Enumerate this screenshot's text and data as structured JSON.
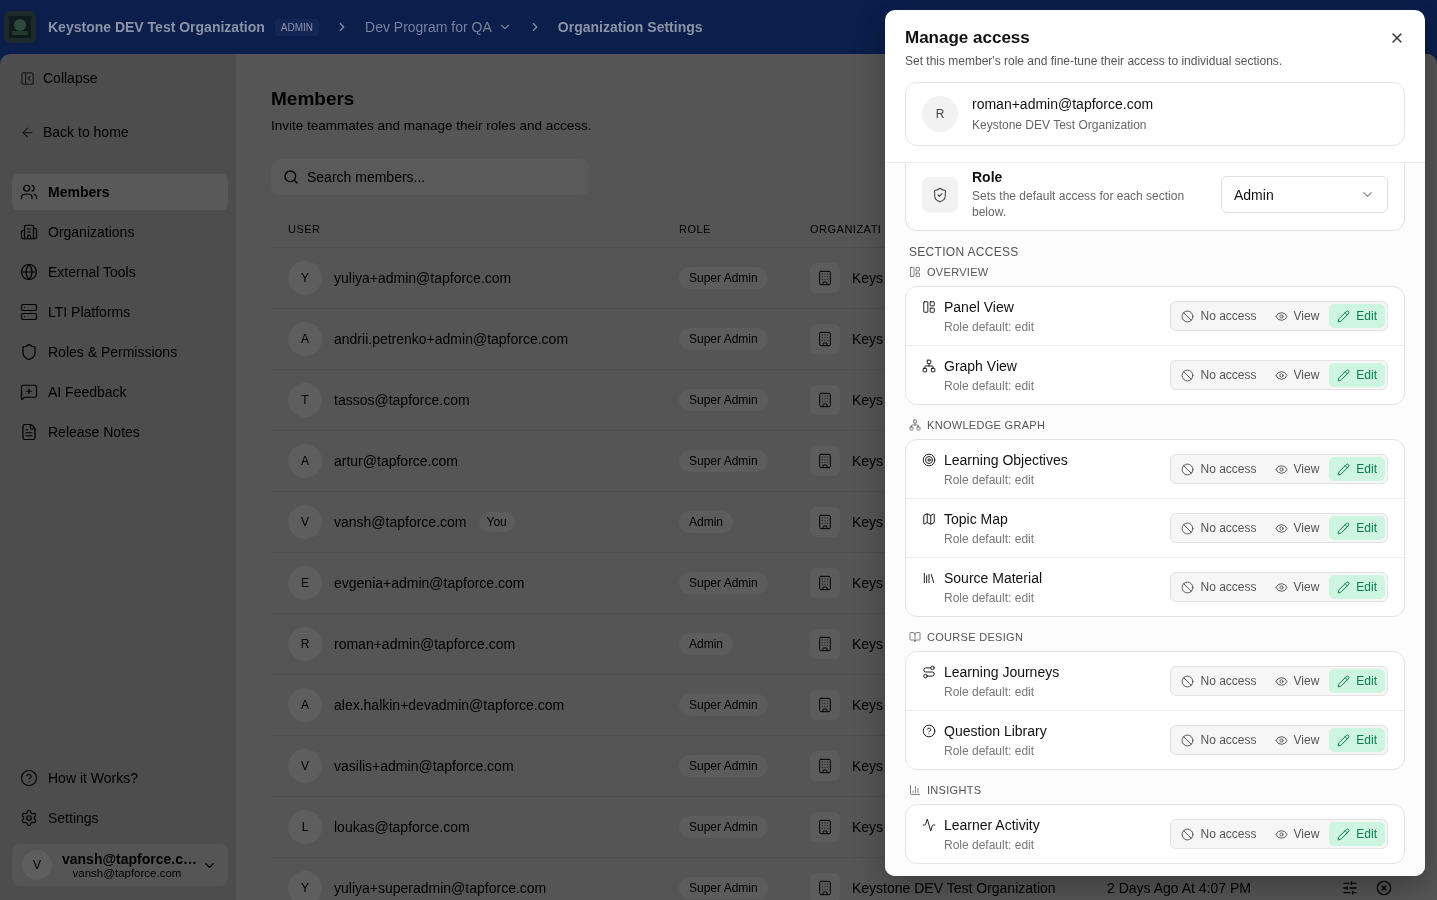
{
  "top_bar": {
    "org_name": "Keystone DEV Test Organization",
    "org_badge": "ADMIN",
    "program": "Dev Program for QA",
    "page": "Organization Settings"
  },
  "sidebar": {
    "collapse": "Collapse",
    "back": "Back to home",
    "items": [
      {
        "kind": "members",
        "label": "Members",
        "selected": true
      },
      {
        "kind": "organizations",
        "label": "Organizations",
        "selected": false
      },
      {
        "kind": "tools",
        "label": "External Tools",
        "selected": false
      },
      {
        "kind": "platforms",
        "label": "LTI Platforms",
        "selected": false
      },
      {
        "kind": "roles",
        "label": "Roles & Permissions",
        "selected": false
      },
      {
        "kind": "feedback",
        "label": "AI Feedback",
        "selected": false
      },
      {
        "kind": "notes",
        "label": "Release Notes",
        "selected": false
      }
    ],
    "footer_items": [
      {
        "kind": "help",
        "label": "How it Works?"
      },
      {
        "kind": "settings",
        "label": "Settings"
      }
    ],
    "user": {
      "initial": "V",
      "name": "vansh@tapforce.c…",
      "email": "vansh@tapforce.com"
    }
  },
  "members": {
    "title": "Members",
    "subtitle": "Invite teammates and manage their roles and access.",
    "search": {
      "placeholder": "Search members..."
    },
    "columns": [
      "USER",
      "ROLE",
      "ORGANIZATI"
    ],
    "rows": [
      {
        "initial": "Y",
        "email": "yuliya+admin@tapforce.com",
        "role": "Super Admin",
        "organization": "Keys"
      },
      {
        "initial": "A",
        "email": "andrii.petrenko+admin@tapforce.com",
        "role": "Super Admin",
        "organization": "Keys"
      },
      {
        "initial": "T",
        "email": "tassos@tapforce.com",
        "role": "Super Admin",
        "organization": "Keys"
      },
      {
        "initial": "A",
        "email": "artur@tapforce.com",
        "role": "Super Admin",
        "organization": "Keys"
      },
      {
        "initial": "V",
        "email": "vansh@tapforce.com",
        "badge": "You",
        "role": "Admin",
        "organization": "Keys"
      },
      {
        "initial": "E",
        "email": "evgenia+admin@tapforce.com",
        "role": "Super Admin",
        "organization": "Keys"
      },
      {
        "initial": "R",
        "email": "roman+admin@tapforce.com",
        "role": "Admin",
        "organization": "Keys"
      },
      {
        "initial": "A",
        "email": "alex.halkin+devadmin@tapforce.com",
        "role": "Super Admin",
        "organization": "Keys"
      },
      {
        "initial": "V",
        "email": "vasilis+admin@tapforce.com",
        "role": "Super Admin",
        "organization": "Keys"
      },
      {
        "initial": "L",
        "email": "loukas@tapforce.com",
        "role": "Super Admin",
        "organization": "Keys"
      },
      {
        "initial": "Y",
        "email": "yuliya+superadmin@tapforce.com",
        "role": "Super Admin",
        "organization": "Keystone DEV Test Organization",
        "last_active": "2 Days Ago At 4:07 PM"
      }
    ]
  },
  "modal": {
    "title": "Manage access",
    "subtitle": "Set this member's role and fine-tune their access to individual sections.",
    "member": {
      "initial": "R",
      "email": "roman+admin@tapforce.com",
      "organization": "Keystone DEV Test Organization"
    },
    "role": {
      "label": "Role",
      "description": "Sets the default access for each section below.",
      "value": "Admin"
    },
    "section_access_label": "SECTION ACCESS",
    "groups": [
      {
        "kind": "overview",
        "title": "OVERVIEW",
        "items": [
          {
            "kind": "panel",
            "name": "Panel View",
            "default": "Role default: edit",
            "options": [
              {
                "kind": "none",
                "label": "No access",
                "selected": false
              },
              {
                "kind": "view",
                "label": "View",
                "selected": false
              },
              {
                "kind": "edit",
                "label": "Edit",
                "selected": true
              }
            ]
          },
          {
            "kind": "graph",
            "name": "Graph View",
            "default": "Role default: edit",
            "options": [
              {
                "kind": "none",
                "label": "No access",
                "selected": false
              },
              {
                "kind": "view",
                "label": "View",
                "selected": false
              },
              {
                "kind": "edit",
                "label": "Edit",
                "selected": true
              }
            ]
          }
        ]
      },
      {
        "kind": "graph",
        "title": "KNOWLEDGE GRAPH",
        "items": [
          {
            "kind": "target",
            "name": "Learning Objectives",
            "default": "Role default: edit",
            "options": [
              {
                "kind": "none",
                "label": "No access",
                "selected": false
              },
              {
                "kind": "view",
                "label": "View",
                "selected": false
              },
              {
                "kind": "edit",
                "label": "Edit",
                "selected": true
              }
            ]
          },
          {
            "kind": "map",
            "name": "Topic Map",
            "default": "Role default: edit",
            "options": [
              {
                "kind": "none",
                "label": "No access",
                "selected": false
              },
              {
                "kind": "view",
                "label": "View",
                "selected": false
              },
              {
                "kind": "edit",
                "label": "Edit",
                "selected": true
              }
            ]
          },
          {
            "kind": "library",
            "name": "Source Material",
            "default": "Role default: edit",
            "options": [
              {
                "kind": "none",
                "label": "No access",
                "selected": false
              },
              {
                "kind": "view",
                "label": "View",
                "selected": false
              },
              {
                "kind": "edit",
                "label": "Edit",
                "selected": true
              }
            ]
          }
        ]
      },
      {
        "kind": "book",
        "title": "COURSE DESIGN",
        "items": [
          {
            "kind": "route",
            "name": "Learning Journeys",
            "default": "Role default: edit",
            "options": [
              {
                "kind": "none",
                "label": "No access",
                "selected": false
              },
              {
                "kind": "view",
                "label": "View",
                "selected": false
              },
              {
                "kind": "edit",
                "label": "Edit",
                "selected": true
              }
            ]
          },
          {
            "kind": "help",
            "name": "Question Library",
            "default": "Role default: edit",
            "options": [
              {
                "kind": "none",
                "label": "No access",
                "selected": false
              },
              {
                "kind": "view",
                "label": "View",
                "selected": false
              },
              {
                "kind": "edit",
                "label": "Edit",
                "selected": true
              }
            ]
          }
        ]
      },
      {
        "kind": "chart",
        "title": "INSIGHTS",
        "items": [
          {
            "kind": "activity",
            "name": "Learner Activity",
            "default": "Role default: edit",
            "options": [
              {
                "kind": "none",
                "label": "No access",
                "selected": false
              },
              {
                "kind": "view",
                "label": "View",
                "selected": false
              },
              {
                "kind": "edit",
                "label": "Edit",
                "selected": true
              }
            ]
          }
        ]
      }
    ]
  }
}
